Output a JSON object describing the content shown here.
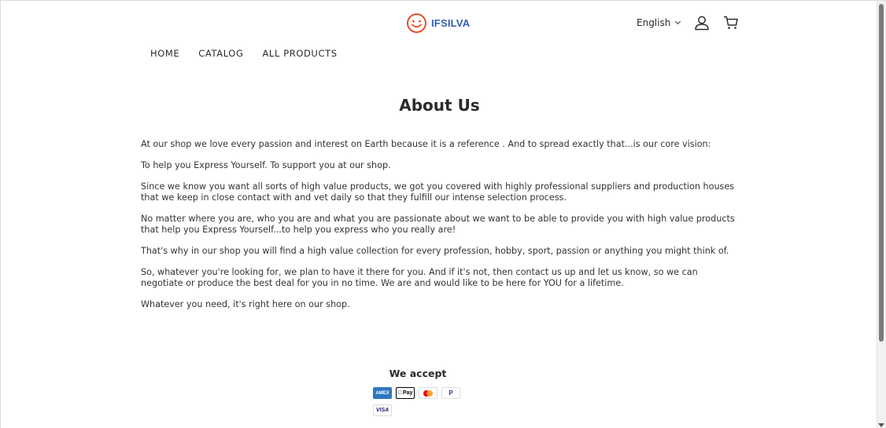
{
  "header": {
    "brand": "IFSILVA",
    "language": "English",
    "brand_color": "#2f5fb3",
    "logo_color": "#e84e2c"
  },
  "nav": {
    "items": [
      "HOME",
      "CATALOG",
      "ALL PRODUCTS"
    ]
  },
  "page": {
    "title": "About Us",
    "paragraphs": [
      "At our shop we love every passion and interest on Earth because it is a reference . And to spread exactly that...is our core vision:",
      "To help you Express Yourself. To support you at our shop.",
      "Since we know you want all sorts of high value products, we got you covered with highly professional suppliers and production houses that we keep in close contact with and vet daily so that they fulfill our intense selection process.",
      "No matter where you are, who you are and what you are passionate about we want to be able to provide you with high value products that help you Express Yourself...to help you express who you really are!",
      "That's why in our shop you will find a high value collection for every profession, hobby, sport, passion or anything you might think of.",
      "So, whatever you're looking for, we plan to have it there for you. And if it's not, then contact us up and let us know, so we can negotiate or produce the best deal for you in no time. We are and would like to be here for YOU for a lifetime.",
      "Whatever you need, it's right here on our shop."
    ]
  },
  "footer": {
    "accept_label": "We accept",
    "payments": [
      {
        "icon": "amex-icon",
        "label": "AMEX"
      },
      {
        "icon": "apple-pay-icon",
        "label": "Pay"
      },
      {
        "icon": "mastercard-icon",
        "label": ""
      },
      {
        "icon": "paypal-icon",
        "label": "P"
      },
      {
        "icon": "visa-icon",
        "label": "VISA"
      }
    ]
  }
}
